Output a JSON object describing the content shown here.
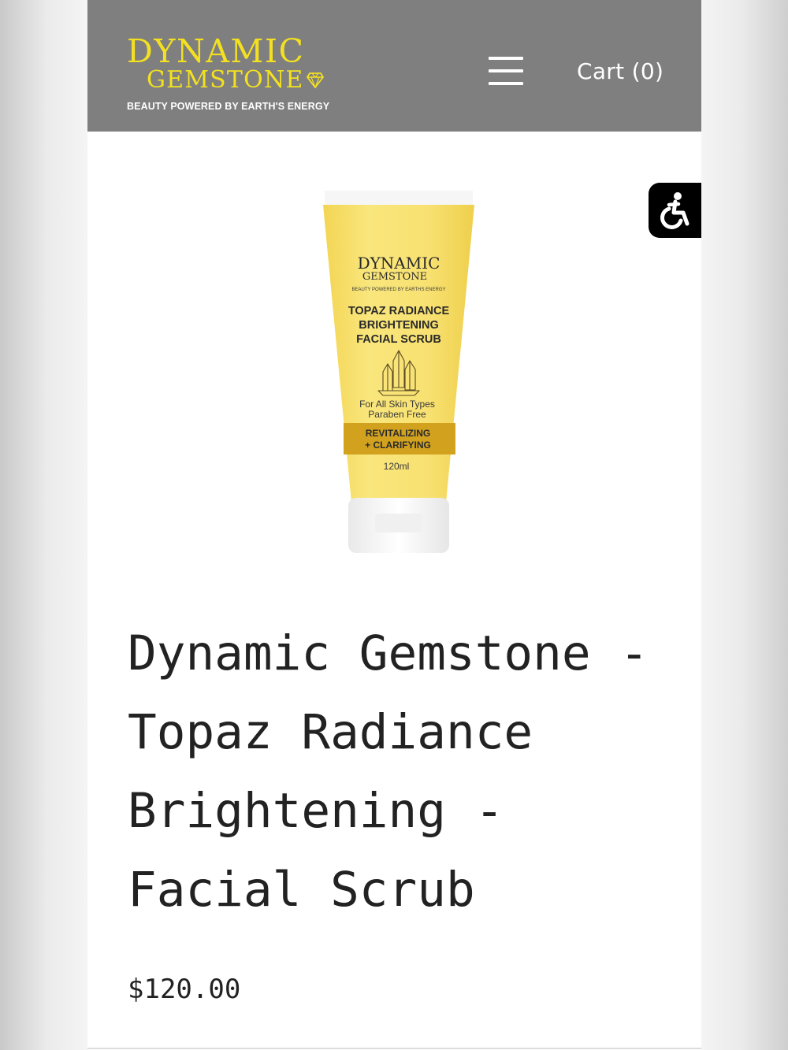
{
  "header": {
    "logo": {
      "line1": "DYNAMIC",
      "line2": "GEMSTONE",
      "tagline": "BEAUTY POWERED BY EARTH'S ENERGY"
    },
    "menu_icon": "hamburger-menu-icon",
    "cart_label": "Cart (0)"
  },
  "accessibility": {
    "icon": "wheelchair-accessibility-icon"
  },
  "product": {
    "image_text": {
      "brand_line1": "DYNAMIC",
      "brand_line2": "GEMSTONE",
      "tagline": "BEAUTY POWERED BY EARTHS ENERGY",
      "name_line1": "TOPAZ RADIANCE",
      "name_line2": "BRIGHTENING",
      "name_line3": "FACIAL SCRUB",
      "feature1": "For All Skin Types",
      "feature2": "Paraben Free",
      "band_line1": "REVITALIZING",
      "band_line2": "+ CLARIFYING",
      "volume": "120ml"
    },
    "title": "Dynamic Gemstone - Topaz Radiance Brightening - Facial Scrub",
    "price": "$120.00"
  },
  "colors": {
    "header_bg": "#7f7f7f",
    "logo_yellow": "#f3e121",
    "tube_yellow": "#f7df6a",
    "band_gold": "#d2a21f",
    "text": "#222222"
  }
}
